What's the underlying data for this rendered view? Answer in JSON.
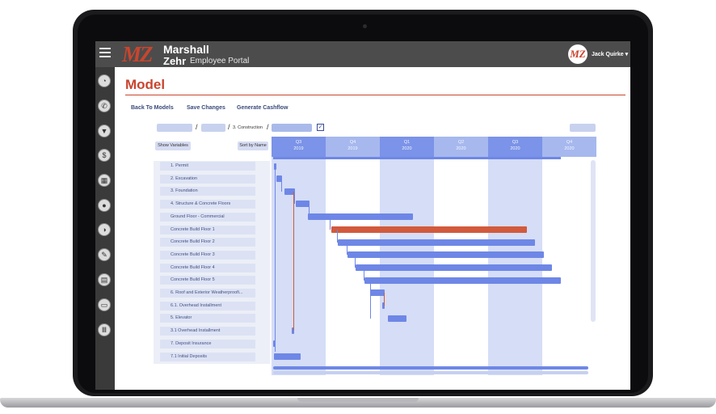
{
  "app": {
    "brand_mark": "MZ",
    "brand_line1": "Marshall",
    "brand_line2": "Zehr",
    "brand_suffix": "Employee Portal",
    "user_avatar": "MZ",
    "user_name": "Jack Quirke ▾"
  },
  "page": {
    "title": "Model",
    "toolbar": {
      "back": "Back To Models",
      "save": "Save Changes",
      "cashflow": "Generate Cashflow"
    },
    "breadcrumb": {
      "current": "3. Construction",
      "slash": "/"
    },
    "controls": {
      "show_variables": "Show Variables",
      "sort_by_name": "Sort by Name"
    }
  },
  "sidebar_icons": [
    "dashboard-icon",
    "phone-icon",
    "filter-icon",
    "money-icon",
    "calendar-icon",
    "lightbulb-icon",
    "chart-icon",
    "edit-icon",
    "calculator-icon",
    "folder-icon",
    "columns-icon"
  ],
  "gantt": {
    "quarters": [
      {
        "q": "Q3",
        "year": "2019"
      },
      {
        "q": "Q4",
        "year": "2019"
      },
      {
        "q": "Q1",
        "year": "2020"
      },
      {
        "q": "Q2",
        "year": "2020"
      },
      {
        "q": "Q3",
        "year": "2020"
      },
      {
        "q": "Q4",
        "year": "2020"
      }
    ],
    "tasks": [
      "1. Permit",
      "2. Excavation",
      "3. Foundation",
      "4. Structure & Concrete Floors",
      "Ground Floor - Commercial",
      "Concrete Build Floor 1",
      "Concrete Build Floor 2",
      "Concrete Build Floor 3",
      "Concrete Build Floor 4",
      "Concrete Build Floor 5",
      "6. Roof and Exterior Weatherproofi...",
      "6.1. Overhead Installment",
      "5. Elevator",
      "3.1 Overhead Installment",
      "7. Deposit Insurance",
      "7.1 Initial Deposits"
    ]
  },
  "colors": {
    "brand": "#c9452e",
    "bar": "#6e87e6",
    "critical_bar": "#d25a3c",
    "header_blue": "#7b93e8"
  }
}
